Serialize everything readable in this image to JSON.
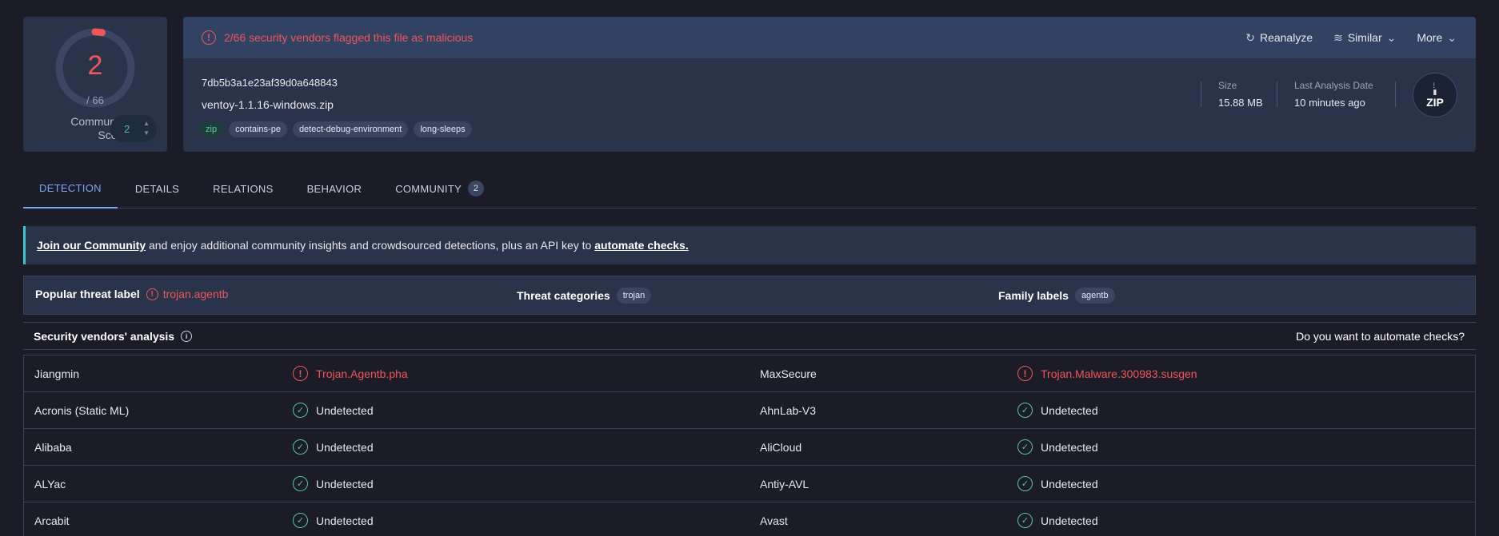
{
  "score": {
    "detections": "2",
    "total": "/ 66",
    "community_label": "Community Score",
    "community_value": "2",
    "malicious_fraction": 0.03
  },
  "summary": {
    "alert": "2/66 security vendors flagged this file as malicious",
    "actions": {
      "reanalyze": "Reanalyze",
      "similar": "Similar",
      "more": "More"
    },
    "hash": "7db5b3a1e23af39d0a648843",
    "filename": "ventoy-1.1.16-windows.zip",
    "tags": [
      "zip",
      "contains-pe",
      "detect-debug-environment",
      "long-sleeps"
    ],
    "size_label": "Size",
    "size_value": "15.88 MB",
    "date_label": "Last Analysis Date",
    "date_value": "10 minutes ago",
    "file_type": "ZIP"
  },
  "tabs": {
    "detection": "DETECTION",
    "details": "DETAILS",
    "relations": "RELATIONS",
    "behavior": "BEHAVIOR",
    "community": "COMMUNITY",
    "community_count": "2"
  },
  "banner": {
    "join_link": "Join our Community",
    "middle": " and enjoy additional community insights and crowdsourced detections, plus an API key to ",
    "automate_link": "automate checks."
  },
  "threat": {
    "popular_label": "Popular threat label",
    "popular_value": "trojan.agentb",
    "categories_label": "Threat categories",
    "categories_value": "trojan",
    "family_label": "Family labels",
    "family_value": "agentb"
  },
  "vendors_header": {
    "title": "Security vendors' analysis",
    "automate_question": "Do you want to automate checks?"
  },
  "vendors": [
    {
      "left_name": "Jiangmin",
      "left_result": "Trojan.Agentb.pha",
      "left_status": "malicious",
      "right_name": "MaxSecure",
      "right_result": "Trojan.Malware.300983.susgen",
      "right_status": "malicious"
    },
    {
      "left_name": "Acronis (Static ML)",
      "left_result": "Undetected",
      "left_status": "clean",
      "right_name": "AhnLab-V3",
      "right_result": "Undetected",
      "right_status": "clean"
    },
    {
      "left_name": "Alibaba",
      "left_result": "Undetected",
      "left_status": "clean",
      "right_name": "AliCloud",
      "right_result": "Undetected",
      "right_status": "clean"
    },
    {
      "left_name": "ALYac",
      "left_result": "Undetected",
      "left_status": "clean",
      "right_name": "Antiy-AVL",
      "right_result": "Undetected",
      "right_status": "clean"
    },
    {
      "left_name": "Arcabit",
      "left_result": "Undetected",
      "left_status": "clean",
      "right_name": "Avast",
      "right_result": "Undetected",
      "right_status": "clean"
    }
  ],
  "colors": {
    "malicious": "#f0555a",
    "clean": "#56c6a5",
    "accent": "#7ba7f5"
  }
}
